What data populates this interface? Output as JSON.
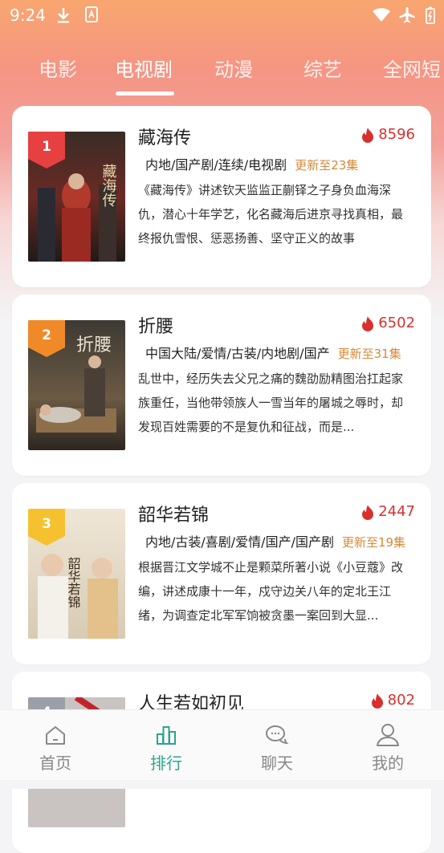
{
  "status": {
    "time": "9:24"
  },
  "tabs": [
    "电影",
    "电视剧",
    "动漫",
    "综艺",
    "全网短"
  ],
  "active_tab": 1,
  "items": [
    {
      "rank": "1",
      "title": "藏海传",
      "heat": "8596",
      "tags": "内地/国产剧/连续/电视剧",
      "update": "更新至23集",
      "desc": "《藏海传》讲述钦天监监正蒯铎之子身负血海深仇，潜心十年学艺，化名藏海后进京寻找真相，最终报仇雪恨、惩恶扬善、坚守正义的故事",
      "badge_color": "#e64040"
    },
    {
      "rank": "2",
      "title": "折腰",
      "heat": "6502",
      "tags": "中国大陆/爱情/古装/内地剧/国产",
      "update": "更新至31集",
      "desc": "乱世中，经历失去父兄之痛的魏劭励精图治扛起家族重任，当他带领族人一雪当年的屠城之辱时，却发现百姓需要的不是复仇和征战，而是...",
      "badge_color": "#f08a28"
    },
    {
      "rank": "3",
      "title": "韶华若锦",
      "heat": "2447",
      "tags": "内地/古装/喜剧/爱情/国产/国产剧",
      "update": "更新至19集",
      "desc": "根据晋江文学城不止是颗菜所著小说《小豆蔻》改编，讲述成康十一年，戍守边关八年的定北王江绪，为调查定北军军饷被贪墨一案回到大显...",
      "badge_color": "#f5c12e"
    },
    {
      "rank": "4",
      "title": "人生若如初见",
      "heat": "802",
      "tags": "",
      "update": "",
      "desc": "",
      "badge_color": "#9aa0a8"
    }
  ],
  "nav": [
    "首页",
    "排行",
    "聊天",
    "我的"
  ],
  "nav_active": 1,
  "colors": {
    "accent": "#2ca58a",
    "heat": "#d8302d",
    "update": "#d48a3a"
  }
}
